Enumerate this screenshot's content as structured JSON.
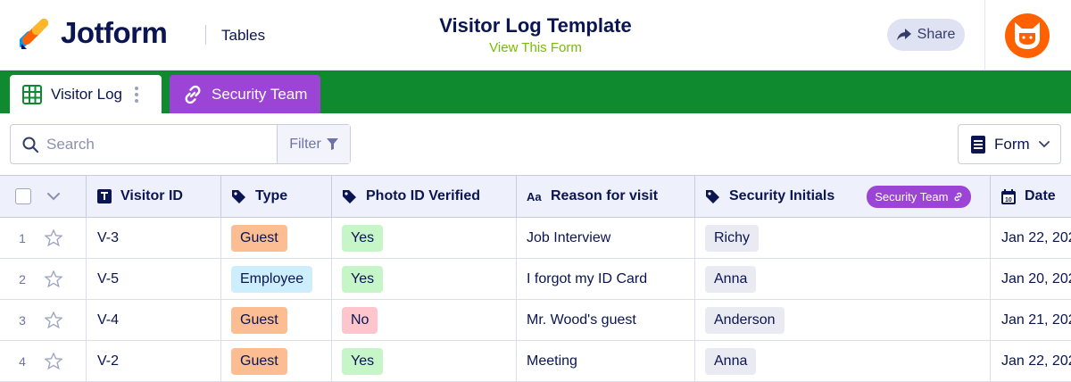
{
  "header": {
    "logo_text": "Jotform",
    "section": "Tables",
    "title": "Visitor Log Template",
    "view_form_link": "View This Form",
    "share_label": "Share"
  },
  "tabs": [
    {
      "label": "Visitor Log",
      "icon": "grid-table-icon",
      "active": true
    },
    {
      "label": "Security Team",
      "icon": "link-icon",
      "active": false
    }
  ],
  "toolbar": {
    "search_placeholder": "Search",
    "filter_label": "Filter",
    "form_label": "Form"
  },
  "table": {
    "columns": [
      {
        "label": "Visitor ID",
        "icon": "text-type-icon"
      },
      {
        "label": "Type",
        "icon": "tag-icon"
      },
      {
        "label": "Photo ID Verified",
        "icon": "tag-icon"
      },
      {
        "label": "Reason for visit",
        "icon": "aa-text-icon"
      },
      {
        "label": "Security Initials",
        "icon": "tag-icon",
        "badge": "Security Team"
      },
      {
        "label": "Date",
        "icon": "calendar-icon"
      }
    ],
    "rows": [
      {
        "num": "1",
        "visitor_id": "V-3",
        "type": "Guest",
        "photo_id": "Yes",
        "reason": "Job Interview",
        "initials": "Richy",
        "date": "Jan 22, 202"
      },
      {
        "num": "2",
        "visitor_id": "V-5",
        "type": "Employee",
        "photo_id": "Yes",
        "reason": "I forgot my ID Card",
        "initials": "Anna",
        "date": "Jan 20, 202"
      },
      {
        "num": "3",
        "visitor_id": "V-4",
        "type": "Guest",
        "photo_id": "No",
        "reason": "Mr. Wood's guest",
        "initials": "Anderson",
        "date": "Jan 21, 202"
      },
      {
        "num": "4",
        "visitor_id": "V-2",
        "type": "Guest",
        "photo_id": "Yes",
        "reason": "Meeting",
        "initials": "Anna",
        "date": "Jan 22, 202"
      }
    ]
  },
  "colors": {
    "brand_navy": "#0a1551",
    "tabbar_green": "#0f8a2f",
    "linked_purple": "#9b44d6",
    "avatar_orange": "#ff6100",
    "guest": "#fbbd91",
    "employee": "#cdeefc",
    "yes": "#c6f5c7",
    "no": "#fec6cc"
  }
}
